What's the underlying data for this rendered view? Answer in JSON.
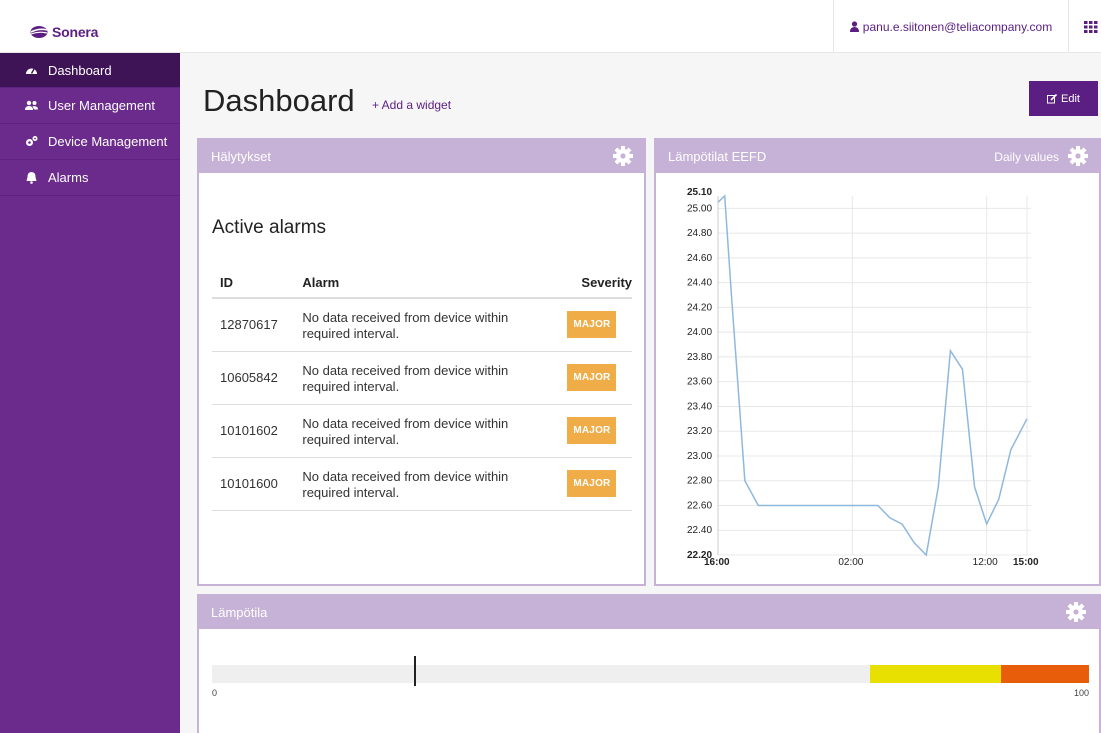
{
  "brand": {
    "name": "Sonera",
    "color": "#5b1e82"
  },
  "header": {
    "user_email": "panu.e.siitonen@teliacompany.com",
    "apps_icon": "grid-icon"
  },
  "sidebar": {
    "items": [
      {
        "label": "Dashboard",
        "icon": "tachometer-icon",
        "active": true
      },
      {
        "label": "User Management",
        "icon": "users-icon",
        "active": false
      },
      {
        "label": "Device Management",
        "icon": "cogs-icon",
        "active": false
      },
      {
        "label": "Alarms",
        "icon": "bell-icon",
        "active": false
      }
    ]
  },
  "main": {
    "title": "Dashboard",
    "add_widget": "+ Add a widget",
    "edit_label": "Edit"
  },
  "alarm_widget": {
    "title": "Hälytykset",
    "heading": "Active alarms",
    "columns": [
      "ID",
      "Alarm",
      "Severity"
    ],
    "rows": [
      {
        "id": "12870617",
        "alarm": "No data received from device within required interval.",
        "severity": "MAJOR"
      },
      {
        "id": "10605842",
        "alarm": "No data received from device within required interval.",
        "severity": "MAJOR"
      },
      {
        "id": "10101602",
        "alarm": "No data received from device within required interval.",
        "severity": "MAJOR"
      },
      {
        "id": "10101600",
        "alarm": "No data received from device within required interval.",
        "severity": "MAJOR"
      }
    ],
    "severity_color": "#efac47"
  },
  "temp_widget": {
    "title": "Lämpötilat EEFD",
    "mode": "Daily values"
  },
  "gauge_widget": {
    "title": "Lämpötila",
    "min": "0",
    "max": "100",
    "value_fraction": 0.23,
    "zones": [
      {
        "from": 0.75,
        "to": 0.9,
        "color": "#e8e000"
      },
      {
        "from": 0.9,
        "to": 1.0,
        "color": "#e85d0a"
      }
    ]
  },
  "chart_data": {
    "type": "line",
    "title": "",
    "xlabel": "",
    "ylabel": "",
    "ylim": [
      22.2,
      25.1
    ],
    "yticks": [
      "22.20",
      "22.40",
      "22.60",
      "22.80",
      "23.00",
      "23.20",
      "23.40",
      "23.60",
      "23.80",
      "24.00",
      "24.20",
      "24.40",
      "24.60",
      "24.80",
      "25.00",
      "25.10"
    ],
    "xticks": [
      {
        "label": "16:00",
        "hour": 16,
        "bold": true
      },
      {
        "label": "02:00",
        "hour": 26,
        "bold": false
      },
      {
        "label": "12:00",
        "hour": 36,
        "bold": false
      },
      {
        "label": "15:00",
        "hour": 39,
        "bold": true
      }
    ],
    "xlim": [
      16,
      39.3
    ],
    "grid": true,
    "series": [
      {
        "color": "#8fb8dd",
        "x": [
          16,
          16.5,
          17,
          18,
          19,
          20,
          21,
          22,
          23,
          24,
          25,
          26,
          27,
          27.9,
          28.8,
          29.7,
          30.6,
          31.5,
          32.4,
          33.3,
          34.2,
          35.1,
          36,
          36.9,
          37.8,
          39
        ],
        "values": [
          25.05,
          25.1,
          24.3,
          22.8,
          22.6,
          22.6,
          22.6,
          22.6,
          22.6,
          22.6,
          22.6,
          22.6,
          22.6,
          22.6,
          22.5,
          22.45,
          22.3,
          22.2,
          22.75,
          23.85,
          23.7,
          22.75,
          22.45,
          22.65,
          23.05,
          23.3
        ]
      }
    ]
  }
}
